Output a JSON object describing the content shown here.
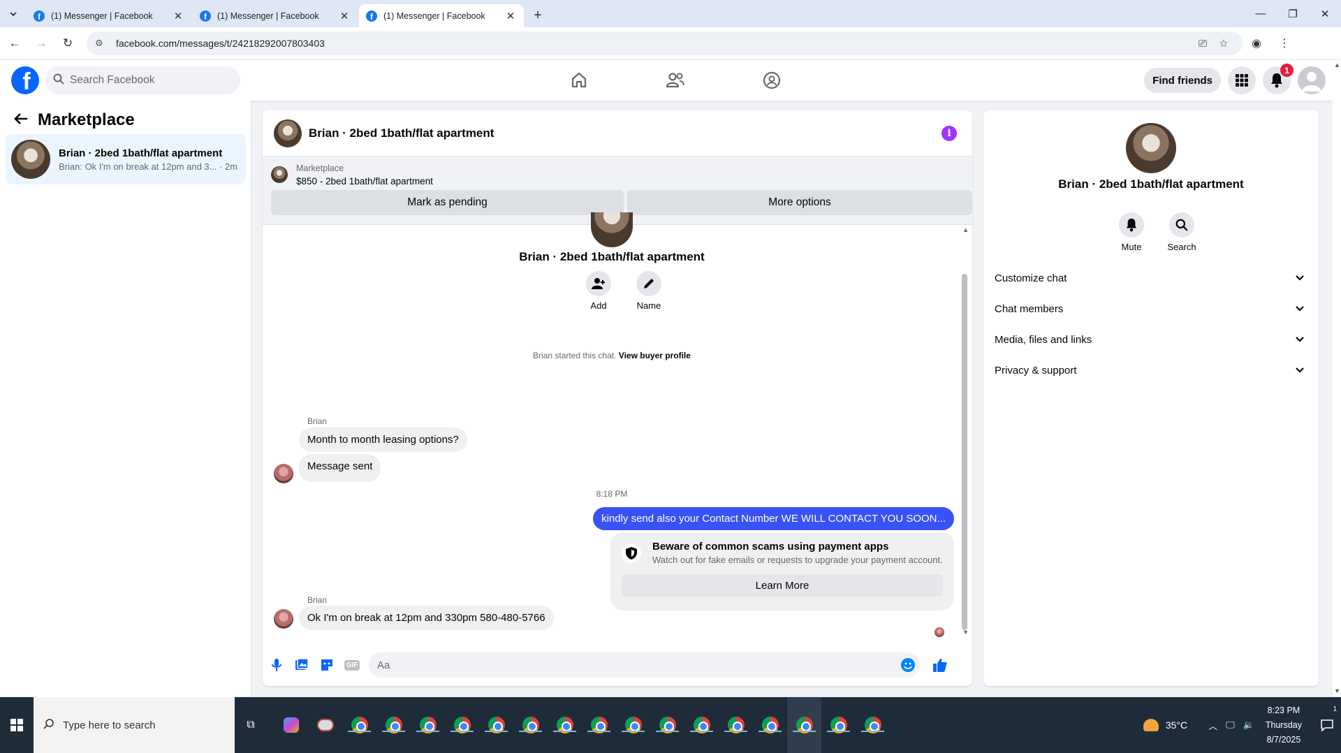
{
  "browser": {
    "tabs": [
      {
        "title": "(1) Messenger | Facebook",
        "active": false
      },
      {
        "title": "(1) Messenger | Facebook",
        "active": false
      },
      {
        "title": "(1) Messenger | Facebook",
        "active": true
      }
    ],
    "url": "facebook.com/messages/t/24218292007803403"
  },
  "fb_header": {
    "search_placeholder": "Search Facebook",
    "find_friends": "Find friends",
    "notification_count": "1"
  },
  "sidebar": {
    "title": "Marketplace",
    "conversation": {
      "title": "Brian · 2bed 1bath/flat apartment",
      "preview": "Brian: Ok I'm on break at 12pm and 3... · 2m"
    }
  },
  "chat": {
    "title": "Brian · 2bed 1bath/flat apartment",
    "listing": {
      "source": "Marketplace",
      "price_title": "$850 - 2bed 1bath/flat apartment",
      "mark_pending": "Mark as pending",
      "more_options": "More options"
    },
    "thread_name": "Brian · 2bed 1bath/flat apartment",
    "actions": [
      {
        "label": "Add"
      },
      {
        "label": "Name"
      }
    ],
    "started_text": "Brian started this chat.",
    "view_profile": "View buyer profile",
    "messages": {
      "sender1": "Brian",
      "msg1": "Month to month leasing options?",
      "msg2": "Message sent",
      "time": "8:18 PM",
      "out1": "kindly send also your Contact Number  WE WILL CONTACT YOU SOON...",
      "scam_title": "Beware of common scams using payment apps",
      "scam_sub": "Watch out for fake emails or requests to upgrade your payment account.",
      "scam_button": "Learn More",
      "sender2": "Brian",
      "msg3": "Ok I'm on break at 12pm and 330pm 580-480-5766"
    },
    "composer_placeholder": "Aa",
    "gif_label": "GIF"
  },
  "right_panel": {
    "name": "Brian · 2bed 1bath/flat apartment",
    "actions": [
      {
        "label": "Mute"
      },
      {
        "label": "Search"
      }
    ],
    "sections": [
      "Customize chat",
      "Chat members",
      "Media, files and links",
      "Privacy & support"
    ]
  },
  "taskbar": {
    "search_placeholder": "Type here to search",
    "temperature": "35°C",
    "time": "8:23 PM",
    "day": "Thursday",
    "date": "8/7/2025",
    "notif_count": "1"
  },
  "colors": {
    "fb_blue": "#0866ff",
    "outgoing_bubble": "#3852f5",
    "info_purple": "#a033ff",
    "badge_red": "#e41e3f"
  }
}
